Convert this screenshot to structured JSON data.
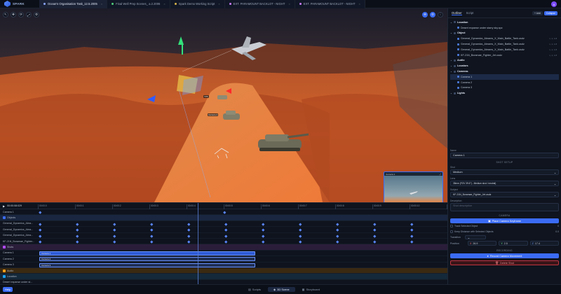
{
  "app": {
    "name": "SPARK",
    "user_initial": "A"
  },
  "tabs": [
    {
      "label": "Ocean's Organisation Task_12.5.2005",
      "color": "#8aa4ff",
      "active": true
    },
    {
      "label": "Final Well Prep Scenes_ a.2.2006",
      "color": "#4fcf7a",
      "active": false
    },
    {
      "label": "Spark Demo Working Script",
      "color": "#d6b24a",
      "active": false
    },
    {
      "label": "EXT. PARAMOUNT BACKLOT - NIGHT",
      "color": "#c77bff",
      "active": false
    },
    {
      "label": "EXT. PARAMOUNT BACKLOT - NIGHT",
      "color": "#c77bff",
      "active": false
    }
  ],
  "viewport": {
    "tools_left": [
      "↖",
      "✥",
      "⟳",
      "⤢",
      "⚙"
    ],
    "tools_right": [
      "✥",
      "⚙",
      "⋮"
    ],
    "tags": [
      {
        "text": "TP5"
      },
      {
        "text": "Camera 2"
      }
    ],
    "preview_title": "Camera 1"
  },
  "timeline": {
    "timecode": "00:00:08:029",
    "ruler": [
      "00:00:0",
      "00:00:1",
      "00:00:2",
      "00:00:3",
      "00:00:4",
      "00:00:5",
      "00:00:6",
      "00:00:7",
      "00:00:8",
      "00:00:9",
      "00:00:10",
      "00:00:11"
    ],
    "rows": [
      {
        "label": "Camera 1",
        "kind": "plain"
      },
      {
        "label": "Objects",
        "kind": "group"
      },
      {
        "label": "General_Dynamics_Abra...",
        "kind": "item"
      },
      {
        "label": "General_Dynamics_Abra...",
        "kind": "item"
      },
      {
        "label": "General_Dynamics_Abra...",
        "kind": "item"
      },
      {
        "label": "KF-21N_Boramae_Fighter...",
        "kind": "item"
      },
      {
        "label": "Shots",
        "kind": "shots"
      },
      {
        "label": "Camera 1",
        "kind": "shot"
      },
      {
        "label": "Camera 2",
        "kind": "shot"
      },
      {
        "label": "Camera 3",
        "kind": "shot"
      },
      {
        "label": "Audio",
        "kind": "audio"
      },
      {
        "label": "Location",
        "kind": "loc"
      },
      {
        "label": "Desert expanse under st...",
        "kind": "item"
      }
    ],
    "clips": [
      {
        "label": "Camera 1"
      },
      {
        "label": "Camera 2"
      },
      {
        "label": "Camera 3"
      }
    ]
  },
  "bottom": {
    "help": "Help",
    "modes": [
      {
        "label": "Scripts",
        "active": false
      },
      {
        "label": "3D Scene",
        "active": true
      },
      {
        "label": "Storyboard",
        "active": false
      }
    ]
  },
  "panel": {
    "tabs": [
      "Outliner",
      "Script"
    ],
    "btn_add": "+ Add",
    "btn_collapse": "Collapse",
    "outliner": [
      {
        "label": "Location",
        "kind": "head",
        "meta": ""
      },
      {
        "label": "Desert expanse under starry sky.spz",
        "kind": "child",
        "meta": ""
      },
      {
        "label": "Object",
        "kind": "head",
        "meta": ""
      },
      {
        "label": "General_Dynamics_Abrams_X_Main_Battle_Tank.usdz",
        "kind": "child",
        "meta": "x, 1, 1.8"
      },
      {
        "label": "General_Dynamics_Abrams_X_Main_Battle_Tank.usdz",
        "kind": "child",
        "meta": "x, 1, 1.8"
      },
      {
        "label": "General_Dynamics_Abrams_X_Main_Battle_Tank.usdz",
        "kind": "child",
        "meta": "x, 1, 1.8"
      },
      {
        "label": "KF-21N_Boramae_Fighter_Jet.usdz",
        "kind": "child",
        "meta": "x, 1, 1.8"
      },
      {
        "label": "Audio",
        "kind": "head",
        "meta": ""
      },
      {
        "label": "Locators",
        "kind": "head",
        "meta": ""
      },
      {
        "label": "Cameras",
        "kind": "head",
        "meta": ""
      },
      {
        "label": "Camera 1",
        "kind": "child",
        "meta": ""
      },
      {
        "label": "Camera 2",
        "kind": "child",
        "meta": ""
      },
      {
        "label": "Camera 3",
        "kind": "child",
        "meta": ""
      },
      {
        "label": "Lights",
        "kind": "head",
        "meta": ""
      }
    ],
    "props": {
      "name_label": "Name",
      "name_value": "Camera 1",
      "shot_setup": "SHOT SETUP",
      "shot_label": "Shot",
      "shot_value": "Medium",
      "lens_label": "Lens",
      "lens_value": "35mm (FOV 39.6°) - Medium shot / neutral)",
      "subject_label": "Subject",
      "subject_value": "KF-21N_Boramae_Fighter_Jet.usdz",
      "desc_label": "Description",
      "desc_placeholder": "Shot description",
      "camera_section": "CAMERA",
      "place_btn": "Place Camera Keyframe",
      "track_sel": "Track Selected Object",
      "track_val": "0",
      "keep_dist": "Keep Distance with Selected Objects",
      "keep_val": "0.0",
      "transition_label": "Transition",
      "position_label": "Position",
      "pos_x": "26.9",
      "pos_y": "2.5",
      "pos_z": "17.4",
      "recording": "RECORDING",
      "record_btn": "Record Camera Movement",
      "delete_btn": "Delete Shot"
    }
  }
}
